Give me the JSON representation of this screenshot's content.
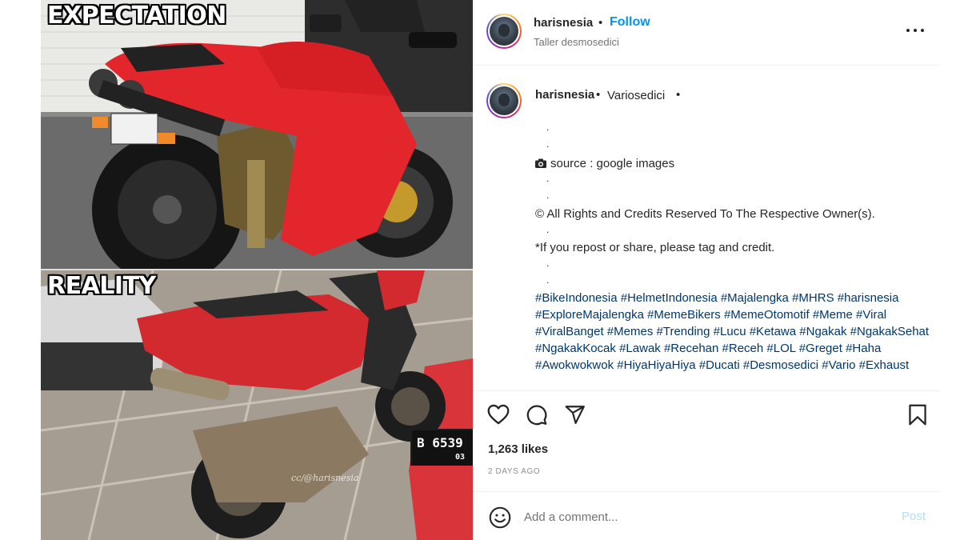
{
  "media": {
    "caption_top": "EXPECTATION",
    "caption_bottom": "REALITY",
    "watermark": "cc/@harisnesia",
    "plate_bottom": "B 6539",
    "plate_bottom_sub": "03"
  },
  "header": {
    "username": "harisnesia",
    "separator": "•",
    "follow_label": "Follow",
    "location": "Taller desmosedici",
    "more_icon": "more-horizontal-icon"
  },
  "caption": {
    "username": "harisnesia",
    "separator": "•",
    "location": "Variosedici",
    "separator2": "•",
    "dot": ".",
    "source_text": "source : google images",
    "camera_icon": "camera-icon",
    "rights_text": "© All Rights and Credits Reserved To The Respective Owner(s).",
    "repost_text": "*If you repost or share, please tag and credit.",
    "hashtags": [
      "#BikeIndonesia",
      "#HelmetIndonesia",
      "#Majalengka",
      "#MHRS",
      "#harisnesia",
      "#ExploreMajalengka",
      "#MemeBikers",
      "#MemeOtomotif",
      "#Meme",
      "#Viral",
      "#ViralBanget",
      "#Memes",
      "#Trending",
      "#Lucu",
      "#Ketawa",
      "#Ngakak",
      "#NgakakSehat",
      "#NgakakKocak",
      "#Lawak",
      "#Recehan",
      "#Receh",
      "#LOL",
      "#Greget",
      "#Haha",
      "#Awokwokwok",
      "#HiyaHiyaHiya",
      "#Ducati",
      "#Desmosedici",
      "#Vario",
      "#Exhaust"
    ]
  },
  "actions": {
    "like_icon": "heart-icon",
    "comment_icon": "comment-icon",
    "share_icon": "paper-plane-icon",
    "save_icon": "bookmark-icon",
    "likes": "1,263 likes",
    "time": "2 DAYS AGO"
  },
  "comment": {
    "emoji_icon": "smiley-icon",
    "placeholder": "Add a comment...",
    "post_label": "Post"
  },
  "colors": {
    "link_blue": "#0095f6",
    "hashtag_blue": "#00376b",
    "post_disabled": "#b3dbff",
    "bike_red": "#e3262b"
  }
}
